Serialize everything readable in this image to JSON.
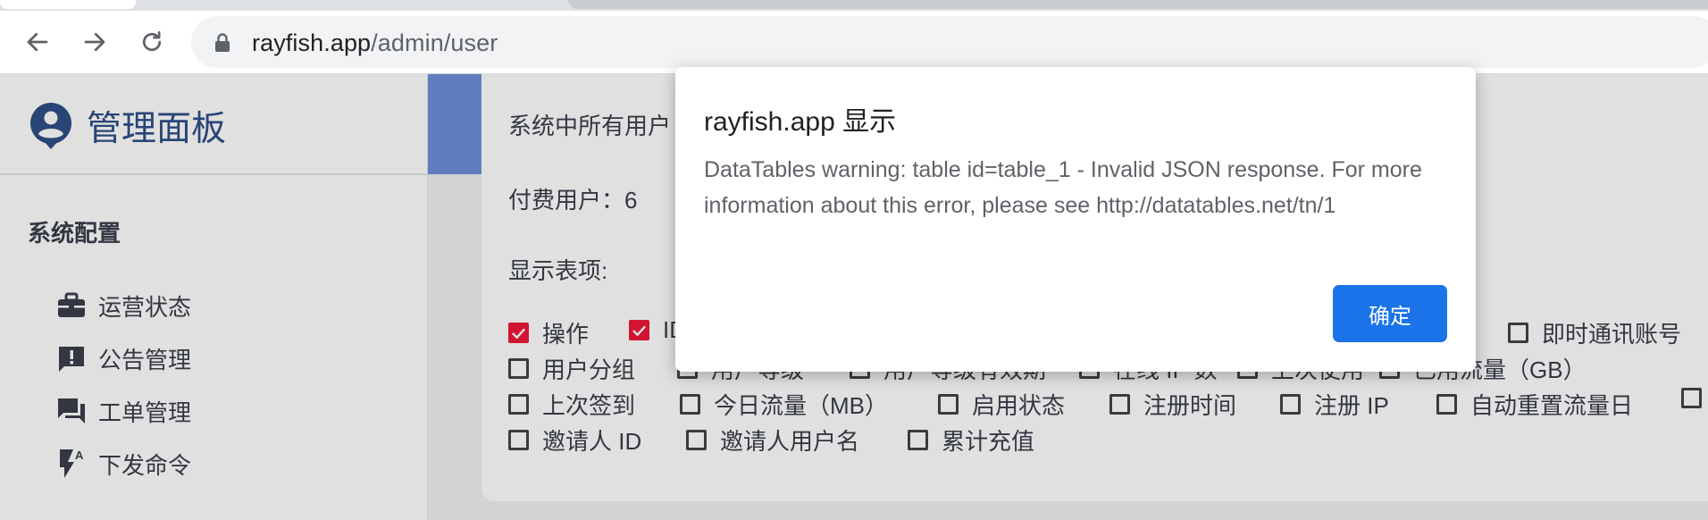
{
  "browser": {
    "url_host": "rayfish.app",
    "url_path": "/admin/user"
  },
  "sidebar": {
    "brand_title": "管理面板",
    "section_title": "系统配置",
    "items": [
      {
        "label": "运营状态",
        "icon": "briefcase-icon"
      },
      {
        "label": "公告管理",
        "icon": "announcement-icon"
      },
      {
        "label": "工单管理",
        "icon": "forum-icon"
      },
      {
        "label": "下发命令",
        "icon": "flash-auto-icon"
      }
    ]
  },
  "main": {
    "summary_line": "系统中所有用户",
    "paid_users": "付费用户：6",
    "columns_label": "显示表项:",
    "checkbox_rows": [
      [
        {
          "label": "操作",
          "checked": true
        },
        {
          "label": "ID",
          "checked": true
        },
        {
          "label": "即时通讯账号",
          "checked": false
        }
      ],
      [
        {
          "label": "用户分组",
          "checked": false
        },
        {
          "label": "用户等级",
          "checked": false
        },
        {
          "label": "用户等级有效期",
          "checked": false
        },
        {
          "label": "在线 IP 数",
          "checked": false
        },
        {
          "label": "上次使用",
          "checked": false
        },
        {
          "label": "已用流量（GB）",
          "checked": false
        }
      ],
      [
        {
          "label": "上次签到",
          "checked": false
        },
        {
          "label": "今日流量（MB）",
          "checked": false
        },
        {
          "label": "启用状态",
          "checked": false
        },
        {
          "label": "注册时间",
          "checked": false
        },
        {
          "label": "注册 IP",
          "checked": false
        },
        {
          "label": "自动重置流量日",
          "checked": false
        },
        {
          "label": "",
          "checked": false
        }
      ],
      [
        {
          "label": "邀请人 ID",
          "checked": false
        },
        {
          "label": "邀请人用户名",
          "checked": false
        },
        {
          "label": "累计充值",
          "checked": false
        }
      ]
    ]
  },
  "dialog": {
    "title": "rayfish.app 显示",
    "message": "DataTables warning: table id=table_1 - Invalid JSON response. For more information about this error, please see http://datatables.net/tn/1",
    "ok_label": "确定"
  },
  "colors": {
    "brand": "#2f4f87",
    "checkbox_checked": "#ee1739",
    "dialog_button": "#1a73e8",
    "hero": "#6f8fd8"
  }
}
